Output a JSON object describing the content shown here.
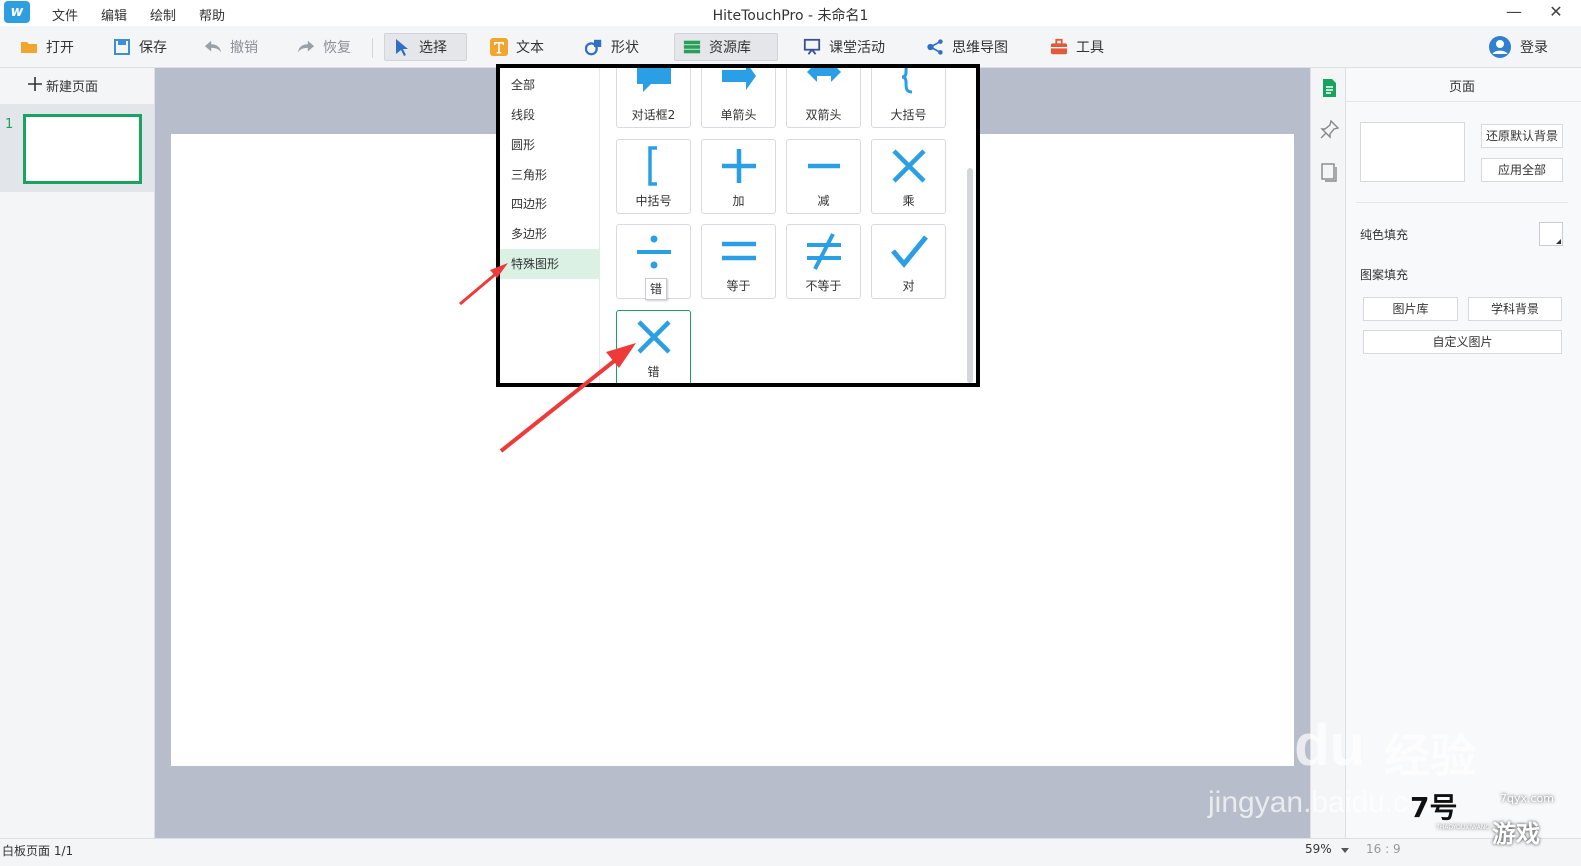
{
  "window": {
    "title": "HiteTouchPro - 未命名1",
    "minimize": "—",
    "close": "✕"
  },
  "menu": [
    "文件",
    "编辑",
    "绘制",
    "帮助"
  ],
  "toolbar": {
    "open": "打开",
    "save": "保存",
    "undo": "撤销",
    "redo": "恢复",
    "select": "选择",
    "text": "文本",
    "shape": "形状",
    "resources": "资源库",
    "activity": "课堂活动",
    "mindmap": "思维导图",
    "tools": "工具",
    "login": "登录"
  },
  "pages_panel": {
    "new_page": "新建页面",
    "thumb_number": "1"
  },
  "shape_popup": {
    "categories": [
      "全部",
      "线段",
      "圆形",
      "三角形",
      "四边形",
      "多边形",
      "特殊图形"
    ],
    "selected_category": "特殊图形",
    "shapes": [
      {
        "label": "对话框2",
        "icon": "speech-bubble-icon"
      },
      {
        "label": "单箭头",
        "icon": "single-arrow-icon"
      },
      {
        "label": "双箭头",
        "icon": "double-arrow-icon"
      },
      {
        "label": "大括号",
        "icon": "curly-brace-icon"
      },
      {
        "label": "中括号",
        "icon": "square-bracket-icon"
      },
      {
        "label": "加",
        "icon": "plus-icon"
      },
      {
        "label": "减",
        "icon": "minus-icon"
      },
      {
        "label": "乘",
        "icon": "multiply-icon"
      },
      {
        "label": "",
        "icon": "divide-icon"
      },
      {
        "label": "等于",
        "icon": "equals-icon"
      },
      {
        "label": "不等于",
        "icon": "not-equal-icon"
      },
      {
        "label": "对",
        "icon": "checkmark-icon"
      },
      {
        "label": "错",
        "icon": "cross-icon"
      }
    ],
    "tooltip": "错",
    "selected_shape": "错"
  },
  "properties": {
    "title": "页面",
    "reset_background": "还原默认背景",
    "apply_all": "应用全部",
    "solid_fill": "纯色填充",
    "pattern_fill": "图案填充",
    "image_library": "图片库",
    "subject_background": "学科背景",
    "custom_image": "自定义图片"
  },
  "status": {
    "page_info": "白板页面 1/1",
    "zoom": "59%",
    "ratio": "16 : 9"
  },
  "watermark": {
    "brand": "Baidu",
    "brand_cn": "经验",
    "url": "jingyan.baidu.com"
  },
  "game_logo": {
    "number": "7号",
    "text": "游戏",
    "url": "7qyx.com",
    "pinyin": "7HAOYOUXIWANG"
  },
  "colors": {
    "accent": "#1aa260",
    "icon_blue": "#2b9fe6",
    "arrow_red": "#ee3a3a"
  }
}
